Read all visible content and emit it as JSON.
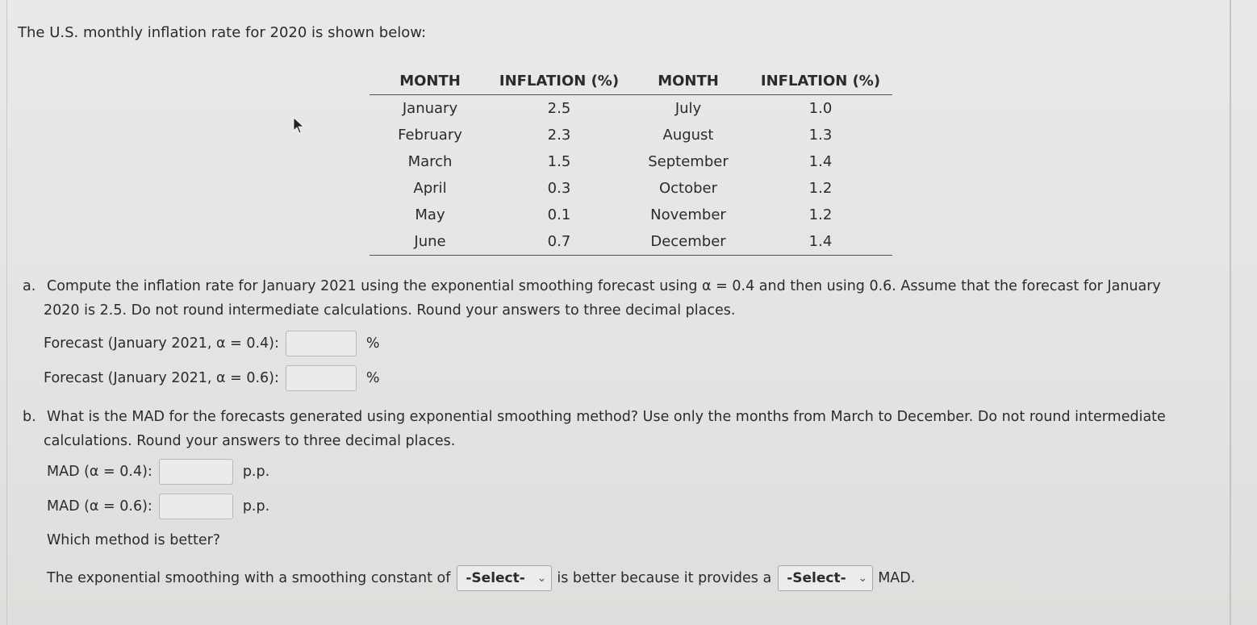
{
  "intro": "The U.S. monthly inflation rate for 2020 is shown below:",
  "table": {
    "headers": [
      "MONTH",
      "INFLATION (%)",
      "MONTH",
      "INFLATION (%)"
    ],
    "rows": [
      [
        "January",
        "2.5",
        "July",
        "1.0"
      ],
      [
        "February",
        "2.3",
        "August",
        "1.3"
      ],
      [
        "March",
        "1.5",
        "September",
        "1.4"
      ],
      [
        "April",
        "0.3",
        "October",
        "1.2"
      ],
      [
        "May",
        "0.1",
        "November",
        "1.2"
      ],
      [
        "June",
        "0.7",
        "December",
        "1.4"
      ]
    ]
  },
  "part_a": {
    "label": "a.",
    "line1": "Compute the inflation rate for January 2021 using the exponential smoothing forecast using α = 0.4 and then using 0.6. Assume that the forecast for January",
    "line2": "2020 is 2.5. Do not round intermediate calculations. Round your answers to three decimal places.",
    "fields": [
      {
        "label": "Forecast (January 2021, α = 0.4):",
        "value": "",
        "unit": "%"
      },
      {
        "label": "Forecast (January 2021, α = 0.6):",
        "value": "",
        "unit": "%"
      }
    ]
  },
  "part_b": {
    "label": "b.",
    "line1": "What is the MAD for the forecasts generated using exponential smoothing method? Use only the months from March to December. Do not round intermediate",
    "line2": "calculations. Round your answers to three decimal places.",
    "fields": [
      {
        "label": "MAD (α = 0.4):",
        "value": "",
        "unit": "p.p."
      },
      {
        "label": "MAD (α = 0.6):",
        "value": "",
        "unit": "p.p."
      }
    ],
    "which_question": "Which method is better?",
    "sentence_pre": "The exponential smoothing with a smoothing constant of",
    "select1": "-Select-",
    "sentence_mid": "is better because it provides a",
    "select2": "-Select-",
    "sentence_post": "MAD."
  }
}
